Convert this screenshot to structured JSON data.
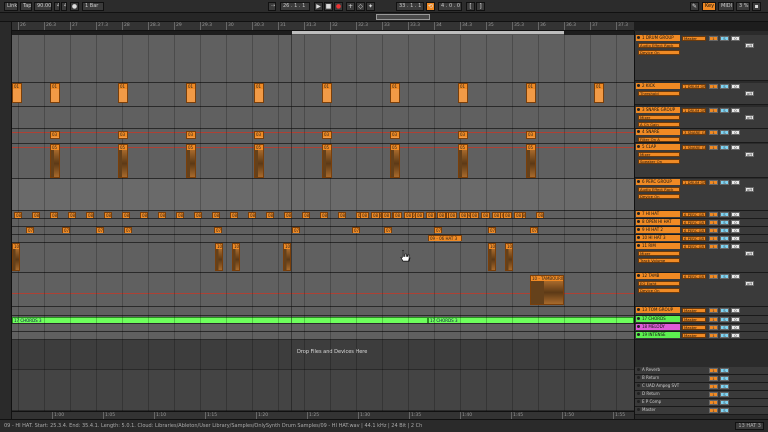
{
  "transport": {
    "link": "Link",
    "tap": "Tap",
    "tempo": "90.00",
    "time_sig_num": "4",
    "time_sig_den": "4",
    "metronome": "",
    "quantize": "1 Bar",
    "arrangement_pos": "26 . 1 . 1",
    "loop_start": "33 . 1 . 1",
    "loop_length": "4 . 0 . 0",
    "key": "Key",
    "midi": "MIDI",
    "cpu": "3 %"
  },
  "ruler": {
    "ticks": [
      "26",
      "26.3",
      "27",
      "27.3",
      "28",
      "28.3",
      "29",
      "29.3",
      "30",
      "30.3",
      "31",
      "31.3",
      "32",
      "32.3",
      "33",
      "33.3",
      "34",
      "34.3",
      "35",
      "35.3",
      "36",
      "36.3",
      "37",
      "37.3"
    ]
  },
  "bottom_ruler": {
    "ticks": [
      "1:00",
      "1:05",
      "1:10",
      "1:15",
      "1:20",
      "1:25",
      "1:30",
      "1:35",
      "1:40",
      "1:45",
      "1:50",
      "1:55"
    ]
  },
  "arrangement": {
    "drop_text": "Drop Files and Devices Here",
    "kick_clip": "01",
    "snare_clip": "03",
    "clap_clip": "05",
    "hat_clip": "08",
    "hat2_clip": "07",
    "ophat_clip": "09 - 06 HAT 3",
    "rim_clip": "10",
    "tamb_clip": "10 - TAMBOURINE",
    "chord_a": "17 CHORDS 3",
    "chord_b": "17 CHORDS 3"
  },
  "tracks": [
    {
      "name": "1 DRUM GROUP",
      "color": "#f08a24",
      "io": "Master",
      "devices": [
        "Audio Effect Rack",
        "Device On"
      ]
    },
    {
      "name": "2 KICK",
      "color": "#f08a24",
      "io": "1 DRUM GR",
      "devices": [
        "Threshold"
      ]
    },
    {
      "name": "3 SNARE GROUP",
      "color": "#f08a24",
      "io": "1 DRUM GR",
      "devices": [
        "Mixer",
        "A Ch Gain"
      ]
    },
    {
      "name": "4 SNARE",
      "color": "#f08a24",
      "io": "3 SNARE GR",
      "devices": [
        "Filter On A"
      ]
    },
    {
      "name": "5 CLAP",
      "color": "#f08a24",
      "io": "3 SNARE GR",
      "devices": [
        "Mixer",
        "Speaker On"
      ]
    },
    {
      "name": "6 PERC GROUP",
      "color": "#f08a24",
      "io": "1 DRUM GR",
      "devices": [
        "Audio Effect Rack",
        "Device On"
      ]
    },
    {
      "name": "7 HI HAT",
      "color": "#f08a24",
      "io": "6 PERC GR"
    },
    {
      "name": "8 OPEN HI HAT",
      "color": "#f08a24",
      "io": "6 PERC GR"
    },
    {
      "name": "9 HI HAT 2",
      "color": "#f08a24",
      "io": "6 PERC GR"
    },
    {
      "name": "10 HI HAT 3",
      "color": "#f08a24",
      "io": "6 PERC GR"
    },
    {
      "name": "11 RIM",
      "color": "#f08a24",
      "io": "6 PERC GR",
      "devices": [
        "Mixer",
        "Track Volume"
      ]
    },
    {
      "name": "12 TAMB",
      "color": "#f08a24",
      "io": "6 PERC GR",
      "devices": [
        "EQ Eight",
        "Device On"
      ]
    },
    {
      "name": "13 TOM GROUP",
      "color": "#f08a24",
      "io": "Master"
    },
    {
      "name": "17 CHORDS",
      "color": "#5cf050",
      "io": "Master"
    },
    {
      "name": "18 MELODY",
      "color": "#e05bd9",
      "io": "Master"
    },
    {
      "name": "19 INTENSE",
      "color": "#5cf050",
      "io": "Master"
    }
  ],
  "returns": [
    {
      "name": "A Reverb"
    },
    {
      "name": "B Return"
    },
    {
      "name": "C UAD Ampeg SVT"
    },
    {
      "name": "D Return"
    },
    {
      "name": "E P Comp"
    },
    {
      "name": "Master"
    }
  ],
  "buttons": {
    "solo": "S",
    "arm": "0",
    "off": "off",
    "mute": "1"
  },
  "status": {
    "text": "09 - HI HAT. Start: 25.3.4. End: 35.4.1. Length: 5.0.1. Cloud: Libraries/Ableton/User Library/Samples/OnlySynth Drum Samples/09 - HI HAT.wav | 44.1 kHz | 24 Bit | 2 Ch",
    "right": "13 HAT 3"
  },
  "colors": {
    "orange": "#f08a24",
    "green": "#5cf050",
    "magenta": "#e05bd9",
    "blue": "#7fd4f3"
  }
}
